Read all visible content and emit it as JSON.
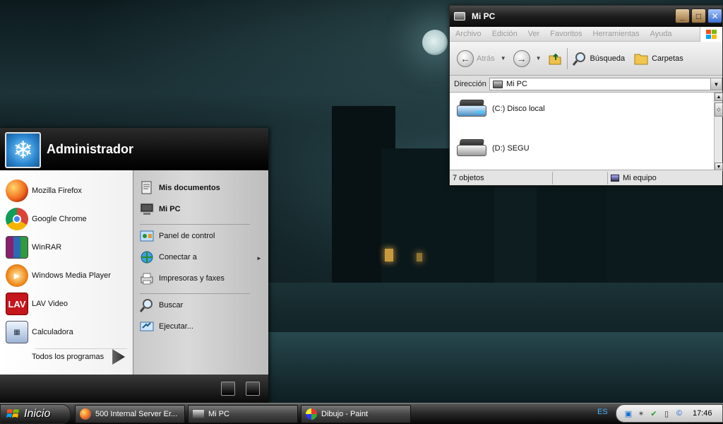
{
  "explorer": {
    "title": "Mi PC",
    "menu": [
      "Archivo",
      "Edición",
      "Ver",
      "Favoritos",
      "Herramientas",
      "Ayuda"
    ],
    "toolbar": {
      "back_label": "Atrás",
      "search_label": "Búsqueda",
      "folders_label": "Carpetas"
    },
    "address": {
      "label": "Dirección",
      "value": "Mi PC"
    },
    "drives": [
      {
        "label": "(C:) Disco local"
      },
      {
        "label": "(D:) SEGU"
      }
    ],
    "status": {
      "count": "7 objetos",
      "location": "Mi equipo"
    }
  },
  "startmenu": {
    "user": "Administrador",
    "programs": [
      {
        "label": "Mozilla Firefox",
        "icon": "firefox-icon"
      },
      {
        "label": "Google Chrome",
        "icon": "chrome-icon"
      },
      {
        "label": "WinRAR",
        "icon": "winrar-icon"
      },
      {
        "label": "Windows Media Player",
        "icon": "media-player-icon"
      },
      {
        "label": "LAV Video",
        "icon": "lav-video-icon"
      },
      {
        "label": "Calculadora",
        "icon": "calculator-icon"
      }
    ],
    "all_programs": "Todos los programas",
    "places": [
      {
        "label": "Mis documentos",
        "icon": "documents-icon"
      },
      {
        "label": "Mi PC",
        "icon": "computer-icon"
      },
      {
        "label": "Panel de control",
        "icon": "control-panel-icon"
      },
      {
        "label": "Conectar a",
        "icon": "network-icon"
      },
      {
        "label": "Impresoras y faxes",
        "icon": "printer-icon"
      },
      {
        "label": "Buscar",
        "icon": "search-icon"
      },
      {
        "label": "Ejecutar...",
        "icon": "run-icon"
      }
    ]
  },
  "taskbar": {
    "start_label": "Inicio",
    "tasks": [
      {
        "label": "500 Internal Server Er...",
        "icon": "firefox-icon"
      },
      {
        "label": "Mi PC",
        "icon": "computer-icon"
      },
      {
        "label": "Dibujo - Paint",
        "icon": "paint-icon"
      }
    ],
    "language": "ES",
    "clock": "17:46"
  },
  "colors": {
    "accent_blue": "#3a6ed3",
    "start_menu_dark": "#0d0d0d",
    "language_text": "#4ab0ff"
  }
}
